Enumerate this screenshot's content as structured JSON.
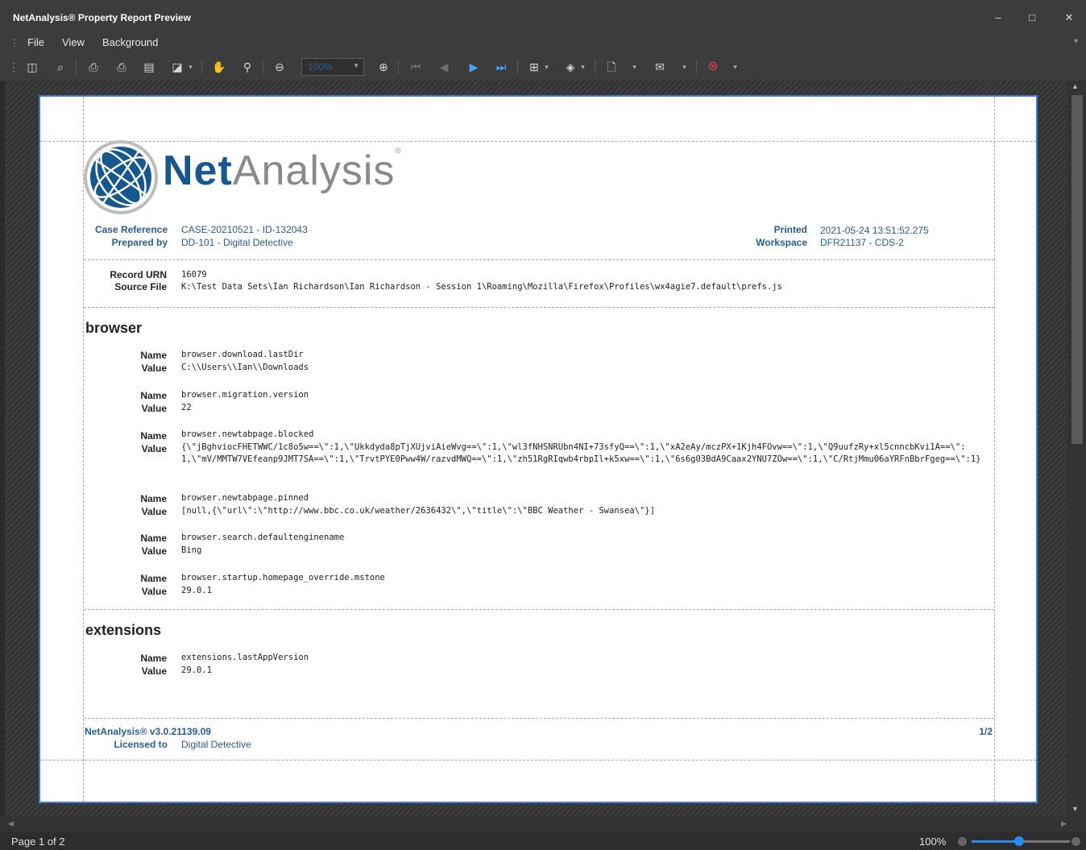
{
  "window": {
    "title": "NetAnalysis® Property Report Preview",
    "minimize": "–",
    "maximize": "□",
    "close": "✕"
  },
  "menu": {
    "file": "File",
    "view": "View",
    "background": "Background"
  },
  "toolbar": {
    "zoom_value": "100%",
    "icons": [
      "document-map-icon",
      "search-icon",
      "print-icon",
      "quick-print-icon",
      "page-setup-icon",
      "scale-icon",
      "hand-tool-icon",
      "magnifier-icon",
      "zoom-out-icon",
      "zoom-in-icon",
      "first-page-icon",
      "previous-page-icon",
      "next-page-icon",
      "last-page-icon",
      "multiple-pages-icon",
      "fill-background-icon",
      "export-icon",
      "send-email-icon",
      "close-preview-icon"
    ]
  },
  "report": {
    "logo_net": "Net",
    "logo_analysis": "Analysis",
    "logo_reg": "®",
    "case_reference_label": "Case Reference",
    "case_reference": "CASE-20210521 - ID-132043",
    "prepared_by_label": "Prepared by",
    "prepared_by": "DD-101 - Digital Detective",
    "printed_label": "Printed",
    "printed": "2021-05-24 13:51:52.275",
    "workspace_label": "Workspace",
    "workspace": "DFR21137 - CDS-2",
    "record_urn_label": "Record URN",
    "record_urn": "16079",
    "source_file_label": "Source File",
    "source_file": "K:\\Test Data Sets\\Ian Richardson\\Ian Richardson - Session 1\\Roaming\\Mozilla\\Firefox\\Profiles\\wx4agie7.default\\prefs.js",
    "name_label": "Name",
    "value_label": "Value",
    "sections": [
      {
        "title": "browser",
        "entries": [
          {
            "name": "browser.download.lastDir",
            "value": "C:\\\\Users\\\\Ian\\\\Downloads"
          },
          {
            "name": "browser.migration.version",
            "value": "22"
          },
          {
            "name": "browser.newtabpage.blocked",
            "value": "{\\\"jBghviocFHETWWC/1c8o5w==\\\":1,\\\"Ukkdyda8pTjXUjviAieWvg==\\\":1,\\\"wl3fNHSNRUbn4NI+73sfyQ==\\\":1,\\\"xA2eAy/mczPX+1Kjh4FOvw==\\\":1,\\\"Q9uufzRy+xl5cnncbKvi1A==\\\":1,\\\"mV/MMTW7VEfeanp9JMT7SA==\\\":1,\\\"TrvtPYE0Pww4W/razvdMWQ==\\\":1,\\\"zh51RgRIqwb4rbpIl+k5xw==\\\":1,\\\"6s6g03BdA9Caax2YNU7ZOw==\\\":1,\\\"C/RtjMmu06aYRFnBbrFgeg==\\\":1}"
          },
          {
            "name": "browser.newtabpage.pinned",
            "value": "[null,{\\\"url\\\":\\\"http://www.bbc.co.uk/weather/2636432\\\",\\\"title\\\":\\\"BBC Weather - Swansea\\\"}]"
          },
          {
            "name": "browser.search.defaultenginename",
            "value": "Bing"
          },
          {
            "name": "browser.startup.homepage_override.mstone",
            "value": "29.0.1"
          }
        ]
      },
      {
        "title": "extensions",
        "entries": [
          {
            "name": "extensions.lastAppVersion",
            "value": "29.0.1"
          }
        ]
      }
    ],
    "footer_version": "NetAnalysis® v3.0.21139.09",
    "footer_page": "1/2",
    "licensed_to_label": "Licensed to",
    "licensed_to": "Digital Detective"
  },
  "status": {
    "page": "Page 1 of 2",
    "zoom": "100%",
    "zoom_level": 0.48
  },
  "colors": {
    "accent": "#2b8cf0",
    "report_blue": "#2a5d8f",
    "logo_blue": "#16588d",
    "page_border": "#3b78d8"
  }
}
